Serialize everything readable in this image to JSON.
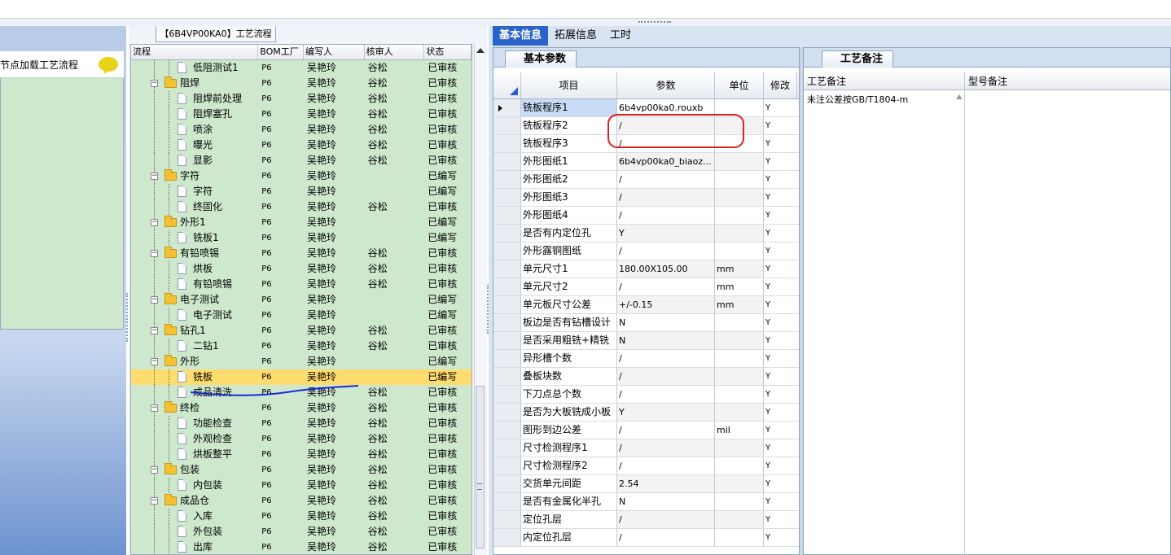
{
  "left": {
    "node_text": "节点加载工艺流程"
  },
  "tree": {
    "title": "【6B4VP00KA0】工艺流程",
    "columns": {
      "flow": "流程",
      "bom": "BOM工厂",
      "author": "编写人",
      "reviewer": "核审人",
      "status": "状态"
    },
    "rows": [
      {
        "depth": 2,
        "kind": "doc",
        "name": "低阻测试1",
        "bom": "P6",
        "author": "吴艳玲",
        "reviewer": "谷松",
        "status": "已审核"
      },
      {
        "depth": 1,
        "kind": "folder",
        "name": "阻焊",
        "bom": "P6",
        "author": "吴艳玲",
        "reviewer": "谷松",
        "status": "已审核"
      },
      {
        "depth": 2,
        "kind": "doc",
        "name": "阻焊前处理",
        "bom": "P6",
        "author": "吴艳玲",
        "reviewer": "谷松",
        "status": "已审核"
      },
      {
        "depth": 2,
        "kind": "doc",
        "name": "阻焊塞孔",
        "bom": "P6",
        "author": "吴艳玲",
        "reviewer": "谷松",
        "status": "已审核"
      },
      {
        "depth": 2,
        "kind": "doc",
        "name": "喷涂",
        "bom": "P6",
        "author": "吴艳玲",
        "reviewer": "谷松",
        "status": "已审核"
      },
      {
        "depth": 2,
        "kind": "doc",
        "name": "曝光",
        "bom": "P6",
        "author": "吴艳玲",
        "reviewer": "谷松",
        "status": "已审核"
      },
      {
        "depth": 2,
        "kind": "doc",
        "name": "显影",
        "bom": "P6",
        "author": "吴艳玲",
        "reviewer": "谷松",
        "status": "已审核"
      },
      {
        "depth": 1,
        "kind": "folder",
        "name": "字符",
        "bom": "P6",
        "author": "吴艳玲",
        "reviewer": "",
        "status": "已编写"
      },
      {
        "depth": 2,
        "kind": "doc",
        "name": "字符",
        "bom": "P6",
        "author": "吴艳玲",
        "reviewer": "",
        "status": "已编写"
      },
      {
        "depth": 2,
        "kind": "doc",
        "name": "终固化",
        "bom": "P6",
        "author": "吴艳玲",
        "reviewer": "谷松",
        "status": "已审核"
      },
      {
        "depth": 1,
        "kind": "folder",
        "name": "外形1",
        "bom": "P6",
        "author": "吴艳玲",
        "reviewer": "",
        "status": "已编写"
      },
      {
        "depth": 2,
        "kind": "doc",
        "name": "铣板1",
        "bom": "P6",
        "author": "吴艳玲",
        "reviewer": "",
        "status": "已编写"
      },
      {
        "depth": 1,
        "kind": "folder",
        "name": "有铅喷锡",
        "bom": "P6",
        "author": "吴艳玲",
        "reviewer": "谷松",
        "status": "已审核"
      },
      {
        "depth": 2,
        "kind": "doc",
        "name": "烘板",
        "bom": "P6",
        "author": "吴艳玲",
        "reviewer": "谷松",
        "status": "已审核"
      },
      {
        "depth": 2,
        "kind": "doc",
        "name": "有铅喷锡",
        "bom": "P6",
        "author": "吴艳玲",
        "reviewer": "谷松",
        "status": "已审核"
      },
      {
        "depth": 1,
        "kind": "folder",
        "name": "电子测试",
        "bom": "P6",
        "author": "吴艳玲",
        "reviewer": "",
        "status": "已编写"
      },
      {
        "depth": 2,
        "kind": "doc",
        "name": "电子测试",
        "bom": "P6",
        "author": "吴艳玲",
        "reviewer": "",
        "status": "已编写"
      },
      {
        "depth": 1,
        "kind": "folder",
        "name": "钻孔1",
        "bom": "P6",
        "author": "吴艳玲",
        "reviewer": "谷松",
        "status": "已审核"
      },
      {
        "depth": 2,
        "kind": "doc",
        "name": "二钻1",
        "bom": "P6",
        "author": "吴艳玲",
        "reviewer": "谷松",
        "status": "已审核"
      },
      {
        "depth": 1,
        "kind": "folder",
        "name": "外形",
        "bom": "P6",
        "author": "吴艳玲",
        "reviewer": "",
        "status": "已编写"
      },
      {
        "depth": 2,
        "kind": "doc",
        "name": "铣板",
        "bom": "P6",
        "author": "吴艳玲",
        "reviewer": "",
        "status": "已编写",
        "selected": true
      },
      {
        "depth": 2,
        "kind": "doc",
        "name": "成品清洗",
        "bom": "P6",
        "author": "吴艳玲",
        "reviewer": "谷松",
        "status": "已审核"
      },
      {
        "depth": 1,
        "kind": "folder",
        "name": "终检",
        "bom": "P6",
        "author": "吴艳玲",
        "reviewer": "谷松",
        "status": "已审核"
      },
      {
        "depth": 2,
        "kind": "doc",
        "name": "功能检查",
        "bom": "P6",
        "author": "吴艳玲",
        "reviewer": "谷松",
        "status": "已审核"
      },
      {
        "depth": 2,
        "kind": "doc",
        "name": "外观检查",
        "bom": "P6",
        "author": "吴艳玲",
        "reviewer": "谷松",
        "status": "已审核"
      },
      {
        "depth": 2,
        "kind": "doc",
        "name": "烘板整平",
        "bom": "P6",
        "author": "吴艳玲",
        "reviewer": "谷松",
        "status": "已审核"
      },
      {
        "depth": 1,
        "kind": "folder",
        "name": "包装",
        "bom": "P6",
        "author": "吴艳玲",
        "reviewer": "谷松",
        "status": "已审核"
      },
      {
        "depth": 2,
        "kind": "doc",
        "name": "内包装",
        "bom": "P6",
        "author": "吴艳玲",
        "reviewer": "谷松",
        "status": "已审核"
      },
      {
        "depth": 1,
        "kind": "folder",
        "name": "成品仓",
        "bom": "P6",
        "author": "吴艳玲",
        "reviewer": "谷松",
        "status": "已审核"
      },
      {
        "depth": 2,
        "kind": "doc",
        "name": "入库",
        "bom": "P6",
        "author": "吴艳玲",
        "reviewer": "谷松",
        "status": "已审核"
      },
      {
        "depth": 2,
        "kind": "doc",
        "name": "外包装",
        "bom": "P6",
        "author": "吴艳玲",
        "reviewer": "谷松",
        "status": "已审核"
      },
      {
        "depth": 2,
        "kind": "doc",
        "name": "出库",
        "bom": "P6",
        "author": "吴艳玲",
        "reviewer": "谷松",
        "status": "已审核"
      }
    ]
  },
  "main_tabs": [
    {
      "label": "基本信息",
      "active": true
    },
    {
      "label": "拓展信息",
      "active": false
    },
    {
      "label": "工时",
      "active": false
    }
  ],
  "params": {
    "tab_label": "基本参数",
    "columns": {
      "item": "项目",
      "value": "参数",
      "unit": "单位",
      "modify": "修改"
    },
    "rows": [
      {
        "item": "铣板程序1",
        "value": "6b4vp00ka0.rouxb",
        "unit": "",
        "modify": "Y",
        "current": true
      },
      {
        "item": "铣板程序2",
        "value": "/",
        "unit": "",
        "modify": "Y"
      },
      {
        "item": "铣板程序3",
        "value": "/",
        "unit": "",
        "modify": "Y"
      },
      {
        "item": "外形图纸1",
        "value": "6b4vp00ka0_biaoz...",
        "unit": "",
        "modify": "Y"
      },
      {
        "item": "外形图纸2",
        "value": "/",
        "unit": "",
        "modify": "Y"
      },
      {
        "item": "外形图纸3",
        "value": "/",
        "unit": "",
        "modify": "Y"
      },
      {
        "item": "外形图纸4",
        "value": "/",
        "unit": "",
        "modify": "Y"
      },
      {
        "item": "是否有内定位孔",
        "value": "Y",
        "unit": "",
        "modify": "Y"
      },
      {
        "item": "外形露铜图纸",
        "value": "/",
        "unit": "",
        "modify": "Y"
      },
      {
        "item": "单元尺寸1",
        "value": "180.00X105.00",
        "unit": "mm",
        "modify": "Y"
      },
      {
        "item": "单元尺寸2",
        "value": "/",
        "unit": "mm",
        "modify": "Y"
      },
      {
        "item": "单元板尺寸公差",
        "value": "+/-0.15",
        "unit": "mm",
        "modify": "Y"
      },
      {
        "item": "板边是否有钻槽设计",
        "value": "N",
        "unit": "",
        "modify": "Y"
      },
      {
        "item": "是否采用粗铣+精铣",
        "value": "N",
        "unit": "",
        "modify": "Y"
      },
      {
        "item": "异形槽个数",
        "value": "/",
        "unit": "",
        "modify": "Y"
      },
      {
        "item": "叠板块数",
        "value": "/",
        "unit": "",
        "modify": "Y"
      },
      {
        "item": "下刀点总个数",
        "value": "/",
        "unit": "",
        "modify": "Y"
      },
      {
        "item": "是否为大板铣成小板",
        "value": "Y",
        "unit": "",
        "modify": "Y"
      },
      {
        "item": "图形到边公差",
        "value": "/",
        "unit": "mil",
        "modify": "Y"
      },
      {
        "item": "尺寸检测程序1",
        "value": "/",
        "unit": "",
        "modify": "Y"
      },
      {
        "item": "尺寸检测程序2",
        "value": "/",
        "unit": "",
        "modify": "Y"
      },
      {
        "item": "交货单元间距",
        "value": "2.54",
        "unit": "",
        "modify": "Y"
      },
      {
        "item": "是否有金属化半孔",
        "value": "N",
        "unit": "",
        "modify": "Y"
      },
      {
        "item": "定位孔层",
        "value": "/",
        "unit": "",
        "modify": "Y"
      },
      {
        "item": "内定位孔层",
        "value": "/",
        "unit": "",
        "modify": "Y"
      }
    ]
  },
  "remarks": {
    "tab_label": "工艺备注",
    "columns": {
      "process": "工艺备注",
      "model": "型号备注"
    },
    "process_text": "未注公差按GB/T1804-m"
  },
  "colors": {
    "selected_row": "#ffdc6e",
    "active_tab": "#2a63c9",
    "tree_bg": "#cde8cc",
    "annotation_red": "#e02020",
    "annotation_blue": "#1a2ad8"
  }
}
